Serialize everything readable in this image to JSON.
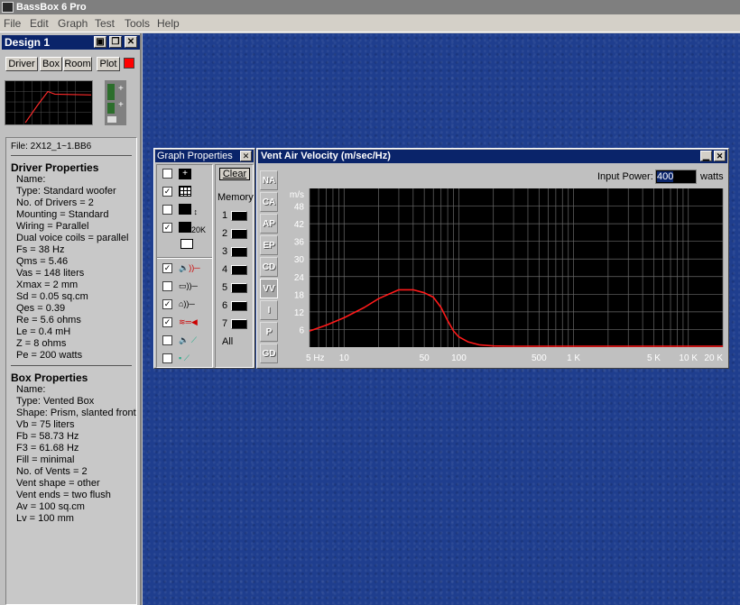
{
  "app": {
    "title": "BassBox 6 Pro"
  },
  "menu": [
    "File",
    "Edit",
    "Graph",
    "Test",
    "Tools",
    "Help"
  ],
  "design": {
    "title": "Design 1",
    "tabs": [
      "Driver",
      "Box",
      "Room",
      "Plot"
    ]
  },
  "info": {
    "file": "File: 2X12_1~1.BB6",
    "driver_heading": "Driver Properties",
    "driver_lines": [
      "Name:",
      "Type: Standard woofer",
      "No. of Drivers = 2",
      "Mounting = Standard",
      "Wiring = Parallel",
      "Dual voice coils = parallel",
      "Fs = 38 Hz",
      "Qms = 5.46",
      "Vas = 148 liters",
      "Xmax = 2 mm",
      "Sd = 0.05 sq.cm",
      "Qes = 0.39",
      "Re = 5.6 ohms",
      "Le = 0.4 mH",
      "Z = 8 ohms",
      "Pe = 200 watts"
    ],
    "box_heading": "Box Properties",
    "box_lines": [
      "Name:",
      "Type: Vented Box",
      "Shape: Prism, slanted front",
      "Vb = 75 liters",
      "Fb = 58.73 Hz",
      "F3 = 61.68 Hz",
      "Fill = minimal",
      "No. of Vents = 2",
      " Vent shape = other",
      " Vent ends = two flush",
      " Av = 100 sq.cm",
      " Lv = 100 mm"
    ]
  },
  "graph_props": {
    "title": "Graph Properties",
    "clear_label": "Clear",
    "memory_label": "Memory",
    "memory_slots": [
      "1",
      "2",
      "3",
      "4",
      "5",
      "6",
      "7"
    ],
    "all_label": "All",
    "icon_20k": "20K",
    "checks": [
      false,
      true,
      false,
      true,
      true,
      false,
      true,
      true,
      false,
      false
    ]
  },
  "graph": {
    "title": "Vent Air Velocity (m/sec/Hz)",
    "input_power_label": "Input Power:",
    "input_power_value": "400",
    "watts_label": "watts",
    "side_tabs": [
      "NA",
      "CA",
      "AP",
      "EP",
      "CD",
      "VV",
      "I",
      "P",
      "GD"
    ],
    "active_tab": "VV"
  },
  "chart_data": {
    "type": "line",
    "ylabel": "m/s",
    "yticks": [
      6,
      12,
      18,
      24,
      30,
      36,
      42,
      48
    ],
    "ylim": [
      0,
      54
    ],
    "xscale": "log",
    "xlim": [
      5,
      20000
    ],
    "xtick_labels": [
      {
        "v": 5,
        "label": "5 Hz"
      },
      {
        "v": 10,
        "label": "10"
      },
      {
        "v": 50,
        "label": "50"
      },
      {
        "v": 100,
        "label": "100"
      },
      {
        "v": 500,
        "label": "500"
      },
      {
        "v": 1000,
        "label": "1 K"
      },
      {
        "v": 5000,
        "label": "5 K"
      },
      {
        "v": 10000,
        "label": "10 K"
      },
      {
        "v": 20000,
        "label": "20 K"
      }
    ],
    "grid": true,
    "series": [
      {
        "color": "#ff1a1a",
        "points": [
          [
            5,
            5.5
          ],
          [
            7,
            7.5
          ],
          [
            10,
            10
          ],
          [
            15,
            13.5
          ],
          [
            20,
            16.5
          ],
          [
            30,
            19.5
          ],
          [
            40,
            19.5
          ],
          [
            50,
            18.5
          ],
          [
            60,
            17
          ],
          [
            70,
            13.5
          ],
          [
            80,
            9
          ],
          [
            90,
            5.5
          ],
          [
            100,
            3.5
          ],
          [
            120,
            1.8
          ],
          [
            150,
            0.8
          ],
          [
            200,
            0.4
          ],
          [
            300,
            0.3
          ],
          [
            1000,
            0.3
          ],
          [
            20000,
            0.3
          ]
        ]
      }
    ]
  }
}
